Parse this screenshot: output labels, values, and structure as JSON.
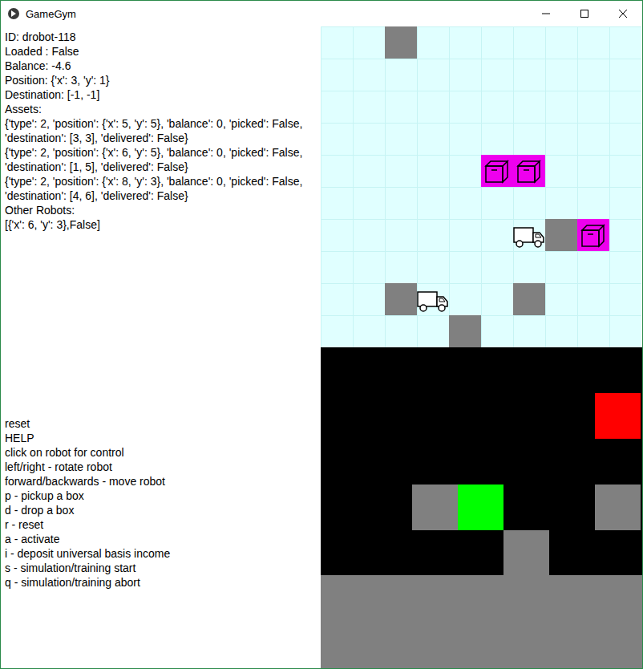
{
  "window": {
    "title": "GameGym"
  },
  "info": [
    "ID: drobot-118",
    "Loaded : False",
    "Balance: -4.6",
    "Position: {'x': 3, 'y': 1}",
    "Destination: [-1, -1]",
    "Assets:",
    "{'type': 2, 'position': {'x': 5, 'y': 5}, 'balance': 0, 'picked': False, 'destination': [3, 3], 'delivered': False}",
    "{'type': 2, 'position': {'x': 6, 'y': 5}, 'balance': 0, 'picked': False, 'destination': [1, 5], 'delivered': False}",
    "{'type': 2, 'position': {'x': 8, 'y': 3}, 'balance': 0, 'picked': False, 'destination': [4, 6], 'delivered': False}",
    "Other Robots:",
    "[{'x': 6, 'y': 3},False]"
  ],
  "help": [
    "reset",
    "HELP",
    "click on robot for control",
    "left/right - rotate robot",
    "forward/backwards - move robot",
    "p - pickup a box",
    "d - drop a box",
    "r - reset",
    "a - activate",
    "i - deposit universal basis income",
    "s - simulation/training start",
    "q - simulation/training abort"
  ],
  "grid": {
    "robots": [
      {
        "x": 3,
        "y": 1
      },
      {
        "x": 6,
        "y": 3
      }
    ],
    "boxes": [
      {
        "x": 5,
        "y": 5
      },
      {
        "x": 6,
        "y": 5
      },
      {
        "x": 8,
        "y": 3
      }
    ],
    "obstacles": [
      {
        "x": 2,
        "y": 9
      },
      {
        "x": 7,
        "y": 3
      },
      {
        "x": 2,
        "y": 1
      },
      {
        "x": 6,
        "y": 1
      },
      {
        "x": 4,
        "y": 0
      }
    ]
  },
  "map": {
    "cells": [
      {
        "col": 6,
        "row": 1,
        "color": "#ff0000"
      },
      {
        "col": 2,
        "row": 3,
        "color": "#808080"
      },
      {
        "col": 3,
        "row": 3,
        "color": "#00ff00"
      },
      {
        "col": 6,
        "row": 3,
        "color": "#808080"
      },
      {
        "col": 4,
        "row": 4,
        "color": "#808080"
      }
    ]
  }
}
